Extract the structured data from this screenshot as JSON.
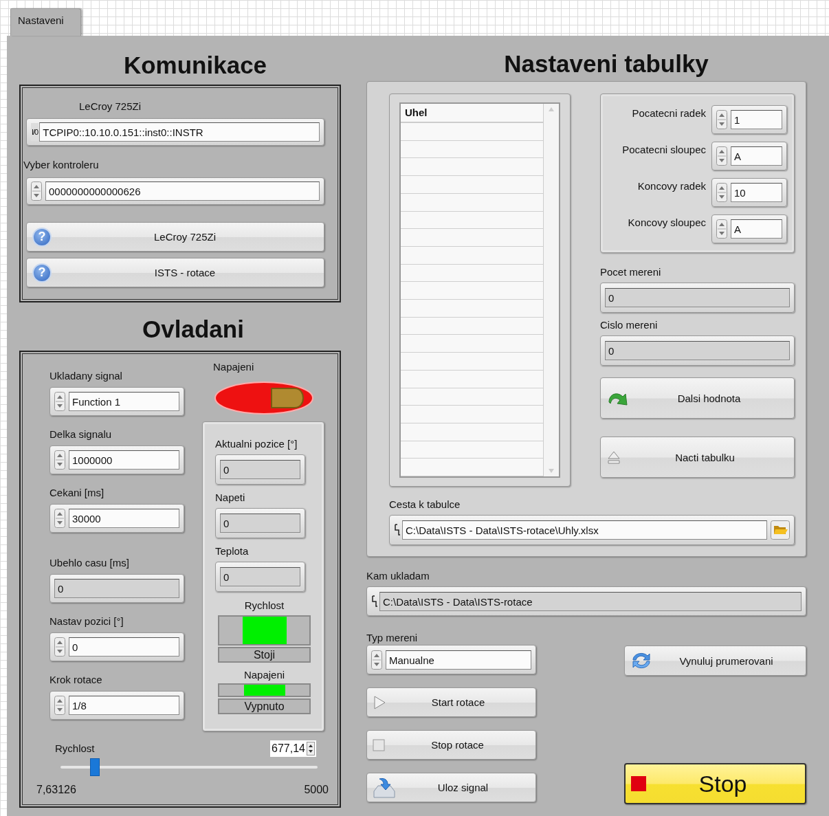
{
  "tab": {
    "label": "Nastaveni",
    "selected": true
  },
  "komunikace": {
    "title": "Komunikace",
    "resource": {
      "label": "LeCroy 725Zi",
      "io_glyph": "I/0",
      "value": "TCPIP0::10.10.0.151::inst0::INSTR"
    },
    "controller": {
      "label": "Vyber kontroleru",
      "value": "0000000000000626"
    },
    "buttons": [
      {
        "label": "LeCroy 725Zi",
        "icon": "?"
      },
      {
        "label": "ISTS - rotace",
        "icon": "?"
      }
    ]
  },
  "ovladani": {
    "title": "Ovladani",
    "controls": [
      {
        "kind": "control",
        "label": "Ukladany signal",
        "value": "Function 1"
      },
      {
        "kind": "control",
        "label": "Delka signalu",
        "value": "1000000"
      },
      {
        "kind": "control",
        "label": "Cekani [ms]",
        "value": "30000"
      },
      {
        "kind": "indicator",
        "label": "Ubehlo casu [ms]",
        "value": "0"
      },
      {
        "kind": "control",
        "label": "Nastav pozici [°]",
        "value": "0"
      },
      {
        "kind": "control",
        "label": "Krok rotace",
        "value": "1/8"
      }
    ],
    "power": {
      "label": "Napajeni",
      "on": false
    },
    "readings": [
      {
        "label": "Aktualni pozice  [°]",
        "value": "0"
      },
      {
        "label": "Napeti",
        "value": "0"
      },
      {
        "label": "Teplota",
        "value": "0"
      }
    ],
    "lamps": [
      {
        "kind": "large",
        "label": "Rychlost",
        "status": "Stoji",
        "on": true
      },
      {
        "kind": "small",
        "label": "Napajeni",
        "status": "Vypnuto",
        "on": true
      }
    ],
    "slider": {
      "label": "Rychlost",
      "value": "677,14",
      "min": "7,63126",
      "max": "5000",
      "level": 0.134
    }
  },
  "tabulka": {
    "title": "Nastaveni tabulky",
    "table": {
      "header": "Uhel"
    },
    "range": [
      {
        "label": "Pocatecni radek",
        "value": "1"
      },
      {
        "label": "Pocatecni sloupec",
        "value": "A"
      },
      {
        "label": "Koncovy radek",
        "value": "10"
      },
      {
        "label": "Koncovy sloupec",
        "value": "A"
      }
    ],
    "counts": [
      {
        "label": "Pocet mereni",
        "value": "0"
      },
      {
        "label": "Cislo mereni",
        "value": "0"
      }
    ],
    "buttons": [
      {
        "kind": "next",
        "label": "Dalsi hodnota"
      },
      {
        "kind": "load",
        "label": "Nacti tabulku"
      }
    ],
    "path": {
      "label": "Cesta k tabulce",
      "value": "C:\\Data\\ISTS - Data\\ISTS-rotace\\Uhly.xlsx"
    }
  },
  "save_path": {
    "label": "Kam ukladam",
    "value": "C:\\Data\\ISTS - Data\\ISTS-rotace"
  },
  "measure_type": {
    "label": "Typ mereni",
    "value": "Manualne"
  },
  "actions": [
    {
      "kind": "start",
      "label": "Start rotace"
    },
    {
      "kind": "stop_rotation",
      "label": "Stop rotace"
    },
    {
      "kind": "save",
      "label": "Uloz signal"
    }
  ],
  "reset": {
    "label": "Vynuluj prumerovani"
  },
  "stop": {
    "label": "Stop"
  }
}
